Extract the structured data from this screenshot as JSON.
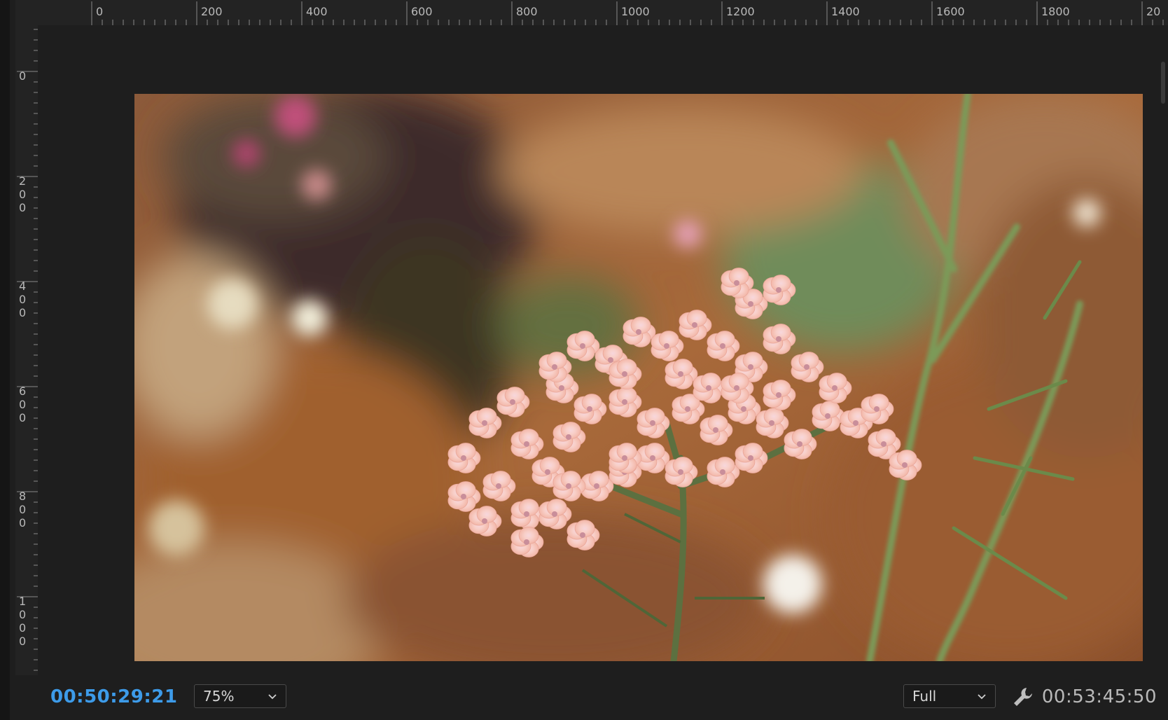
{
  "ruler": {
    "top_labels": [
      "0",
      "200",
      "400",
      "600",
      "800",
      "1000",
      "1200",
      "1400",
      "1600",
      "1800",
      "20"
    ],
    "left_labels": [
      "0",
      "200",
      "400",
      "600",
      "800",
      "1000"
    ]
  },
  "playback": {
    "current_timecode": "00:50:29:21",
    "duration_timecode": "00:53:45:50",
    "zoom_level": "75%",
    "resolution": "Full"
  },
  "icons": {
    "settings": "wrench-icon",
    "dropdown": "chevron-down-icon"
  },
  "colors": {
    "accent_timecode": "#3d9be9",
    "background": "#1e1e1e"
  }
}
